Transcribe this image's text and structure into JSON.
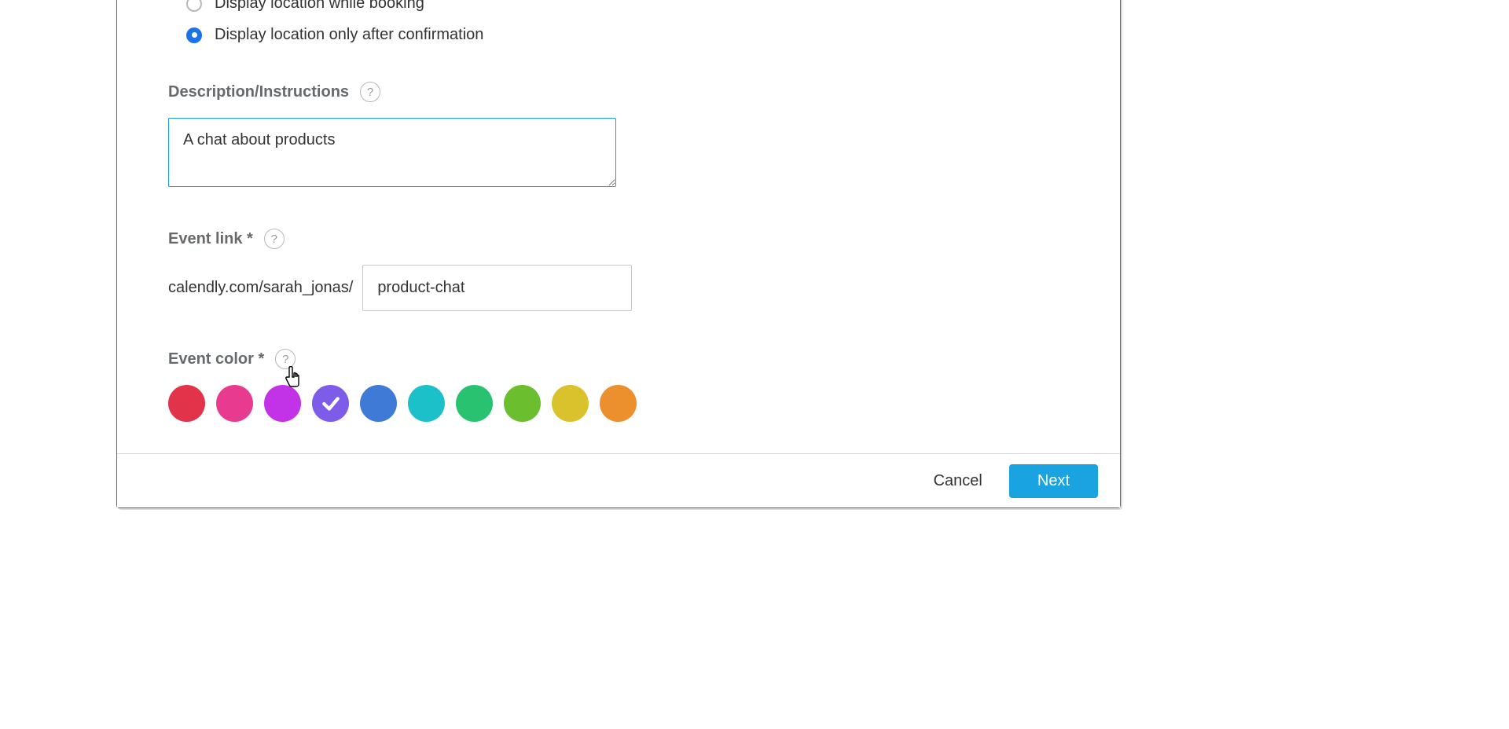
{
  "location_radio": {
    "option1": {
      "label": "Display location while booking",
      "selected": false
    },
    "option2": {
      "label": "Display location only after confirmation",
      "selected": true
    }
  },
  "description": {
    "label": "Description/Instructions",
    "help": "?",
    "value": "A chat about products"
  },
  "event_link": {
    "label": "Event link *",
    "help": "?",
    "prefix": "calendly.com/sarah_jonas/",
    "value": "product-chat"
  },
  "event_color": {
    "label": "Event color *",
    "help": "?",
    "selected_index": 3,
    "swatches": [
      {
        "name": "red",
        "hex": "#e1344a"
      },
      {
        "name": "pink",
        "hex": "#e83a8f"
      },
      {
        "name": "magenta",
        "hex": "#c233e8"
      },
      {
        "name": "violet",
        "hex": "#7c5ce8"
      },
      {
        "name": "blue",
        "hex": "#3f7bd6"
      },
      {
        "name": "teal",
        "hex": "#1bc0c9"
      },
      {
        "name": "green",
        "hex": "#29c271"
      },
      {
        "name": "lime",
        "hex": "#6bbf2f"
      },
      {
        "name": "yellow",
        "hex": "#d9c22b"
      },
      {
        "name": "orange",
        "hex": "#ec8f2d"
      }
    ]
  },
  "footer": {
    "cancel": "Cancel",
    "next": "Next"
  }
}
